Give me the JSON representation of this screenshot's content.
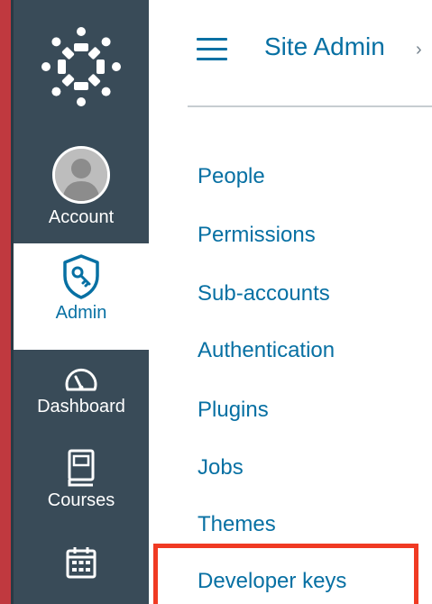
{
  "global_nav": {
    "account_label": "Account",
    "admin_label": "Admin",
    "dashboard_label": "Dashboard",
    "courses_label": "Courses"
  },
  "header": {
    "breadcrumb_label": "Site Admin",
    "breadcrumb_separator": "›"
  },
  "admin_menu": {
    "items": [
      {
        "label": "People"
      },
      {
        "label": "Permissions"
      },
      {
        "label": "Sub-accounts"
      },
      {
        "label": "Authentication"
      },
      {
        "label": "Plugins"
      },
      {
        "label": "Jobs"
      },
      {
        "label": "Themes"
      },
      {
        "label": "Developer keys"
      }
    ]
  },
  "colors": {
    "nav_background": "#394b58",
    "link": "#0770a3",
    "highlight": "#f03a23"
  }
}
